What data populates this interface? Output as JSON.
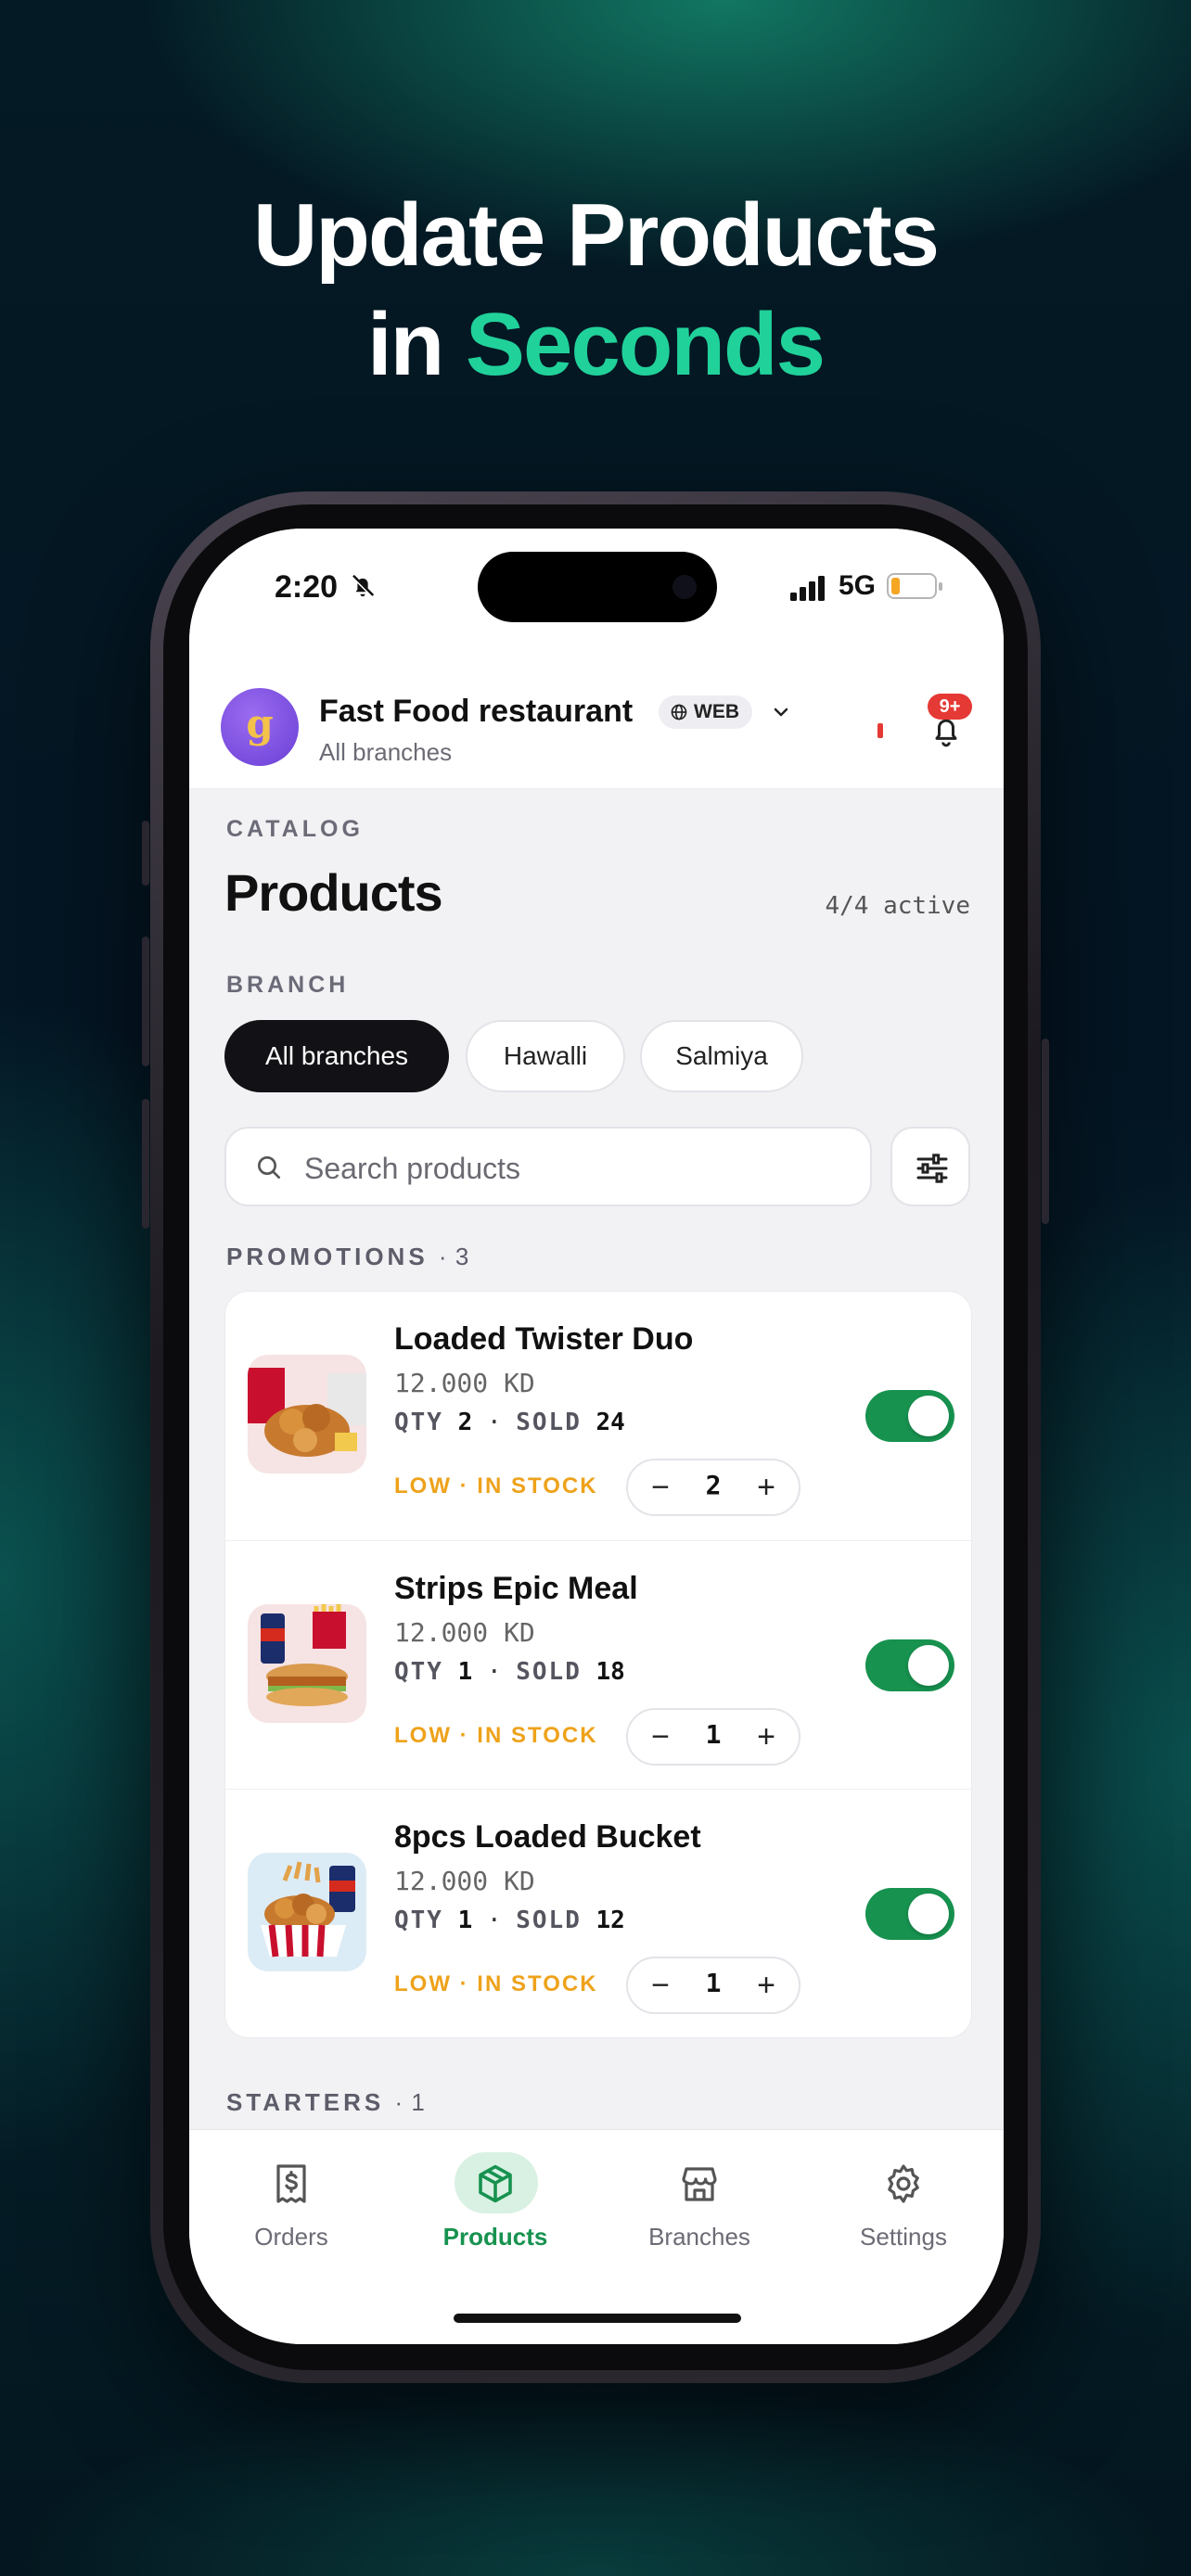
{
  "promo": {
    "line1": "Update Products",
    "line2_prefix": "in ",
    "line2_accent": "Seconds",
    "accent_color": "#21d19a"
  },
  "status_bar": {
    "time": "2:20",
    "network": "5G",
    "battery_level": 0.2,
    "icons": [
      "bell-slash-icon",
      "signal-icon",
      "battery-icon"
    ]
  },
  "header": {
    "store_name": "Fast Food restaurant",
    "badge": "WEB",
    "subtitle": "All branches",
    "notification_badge": "9+",
    "icons": [
      "avatar-logo",
      "globe-icon",
      "chevron-down-icon",
      "bell-icon"
    ]
  },
  "catalog": {
    "kicker": "CATALOG",
    "title": "Products",
    "active_count": "4/4 active"
  },
  "branch": {
    "kicker": "BRANCH",
    "chips": [
      {
        "label": "All branches",
        "active": true
      },
      {
        "label": "Hawalli",
        "active": false
      },
      {
        "label": "Salmiya",
        "active": false
      }
    ]
  },
  "search": {
    "placeholder": "Search products",
    "value": "",
    "icons": [
      "search-icon",
      "filter-sliders-icon"
    ]
  },
  "groups": [
    {
      "label": "PROMOTIONS",
      "count": "3",
      "items": [
        {
          "name": "Loaded Twister Duo",
          "price": "12.000 KD",
          "qty_label": "QTY",
          "qty": "2",
          "sold_label": "SOLD",
          "sold": "24",
          "stock": "LOW · IN STOCK",
          "stepper_value": "2",
          "enabled": true
        },
        {
          "name": "Strips Epic Meal",
          "price": "12.000 KD",
          "qty_label": "QTY",
          "qty": "1",
          "sold_label": "SOLD",
          "sold": "18",
          "stock": "LOW · IN STOCK",
          "stepper_value": "1",
          "enabled": true
        },
        {
          "name": "8pcs Loaded Bucket",
          "price": "12.000 KD",
          "qty_label": "QTY",
          "qty": "1",
          "sold_label": "SOLD",
          "sold": "12",
          "stock": "LOW · IN STOCK",
          "stepper_value": "1",
          "enabled": true
        }
      ]
    },
    {
      "label": "STARTERS",
      "count": "1"
    }
  ],
  "stepper": {
    "minus": "−",
    "plus": "+"
  },
  "separator": "·",
  "tabs": [
    {
      "label": "Orders",
      "icon": "receipt-dollar-icon",
      "active": false
    },
    {
      "label": "Products",
      "icon": "box-icon",
      "active": true
    },
    {
      "label": "Branches",
      "icon": "store-icon",
      "active": false
    },
    {
      "label": "Settings",
      "icon": "gear-icon",
      "active": false
    }
  ],
  "colors": {
    "active_green": "#17924f",
    "warning_amber": "#eea21b",
    "badge_red": "#e53935"
  }
}
